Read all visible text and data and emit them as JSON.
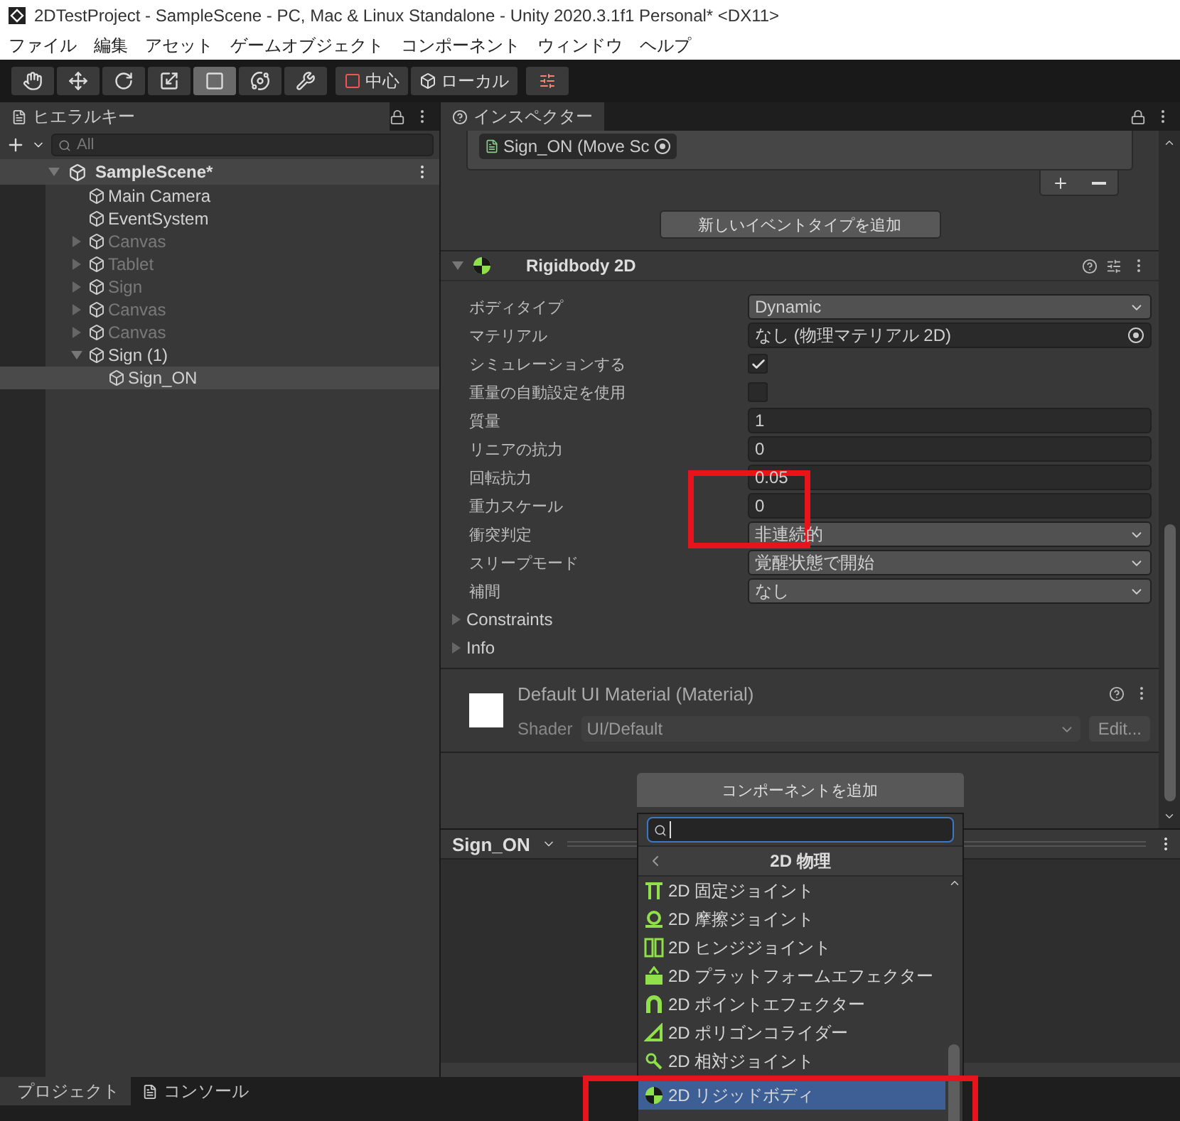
{
  "window": {
    "title": "2DTestProject - SampleScene - PC, Mac & Linux Standalone - Unity 2020.3.1f1 Personal* <DX11>"
  },
  "menu": [
    "ファイル",
    "編集",
    "アセット",
    "ゲームオブジェクト",
    "コンポーネント",
    "ウィンドウ",
    "ヘルプ"
  ],
  "toolbar": {
    "tools": [
      {
        "kind": "hand",
        "selected": false
      },
      {
        "kind": "move",
        "selected": false
      },
      {
        "kind": "rotate",
        "selected": false
      },
      {
        "kind": "scale",
        "selected": false
      },
      {
        "kind": "rect",
        "selected": true
      },
      {
        "kind": "transform",
        "selected": false
      },
      {
        "kind": "custom",
        "selected": false
      }
    ],
    "pivot": "中心",
    "space": "ローカル"
  },
  "hierarchy": {
    "tab": "ヒエラルキー",
    "search_placeholder": "All",
    "scene": "SampleScene*",
    "items": [
      {
        "name": "Main Camera",
        "kind": "leaf",
        "active": true,
        "selected": false
      },
      {
        "name": "EventSystem",
        "kind": "leaf",
        "active": true,
        "selected": false
      },
      {
        "name": "Canvas",
        "kind": "group",
        "expanded": false,
        "active": false,
        "selected": false
      },
      {
        "name": "Tablet",
        "kind": "group",
        "expanded": false,
        "active": false,
        "selected": false
      },
      {
        "name": "Sign",
        "kind": "group",
        "expanded": false,
        "active": false,
        "selected": false
      },
      {
        "name": "Canvas",
        "kind": "group",
        "expanded": false,
        "active": false,
        "selected": false
      },
      {
        "name": "Canvas",
        "kind": "group",
        "expanded": false,
        "active": false,
        "selected": false
      },
      {
        "name": "Sign (1)",
        "kind": "group",
        "expanded": true,
        "active": true,
        "selected": false,
        "children": [
          {
            "name": "Sign_ON",
            "kind": "leaf",
            "active": true,
            "selected": true
          }
        ]
      }
    ]
  },
  "inspector": {
    "tab": "インスペクター",
    "event_object": "Sign_ON (Move Sc",
    "add_event_button": "新しいイベントタイプを追加",
    "component": {
      "title": "Rigidbody 2D",
      "expanded": true,
      "properties": [
        {
          "label": "ボディタイプ",
          "kind": "dropdown",
          "value": "Dynamic"
        },
        {
          "label": "マテリアル",
          "kind": "object",
          "value": "なし (物理マテリアル 2D)"
        },
        {
          "label": "シミュレーションする",
          "kind": "checkbox",
          "checked": true
        },
        {
          "label": "重量の自動設定を使用",
          "kind": "checkbox",
          "checked": false
        },
        {
          "label": "質量",
          "kind": "number",
          "value": "1"
        },
        {
          "label": "リニアの抗力",
          "kind": "number",
          "value": "0"
        },
        {
          "label": "回転抗力",
          "kind": "number",
          "value": "0.05"
        },
        {
          "label": "重力スケール",
          "kind": "number",
          "value": "0"
        },
        {
          "label": "衝突判定",
          "kind": "dropdown",
          "value": "非連続的"
        },
        {
          "label": "スリープモード",
          "kind": "dropdown",
          "value": "覚醒状態で開始"
        },
        {
          "label": "補間",
          "kind": "dropdown",
          "value": "なし"
        }
      ],
      "foldouts": [
        "Constraints",
        "Info"
      ]
    },
    "material": {
      "title": "Default UI Material (Material)",
      "shader_label": "Shader",
      "shader": "UI/Default",
      "edit_button": "Edit..."
    },
    "add_component": "コンポーネントを追加"
  },
  "preview": {
    "title": "Sign_ON"
  },
  "popup": {
    "category": "2D 物理",
    "items": [
      {
        "label": "2D 固定ジョイント",
        "kind": "fixed",
        "selected": false
      },
      {
        "label": "2D 摩擦ジョイント",
        "kind": "friction",
        "selected": false
      },
      {
        "label": "2D ヒンジジョイント",
        "kind": "hinge",
        "selected": false
      },
      {
        "label": "2D プラットフォームエフェクター",
        "kind": "platform",
        "selected": false
      },
      {
        "label": "2D ポイントエフェクター",
        "kind": "point",
        "selected": false
      },
      {
        "label": "2D ポリゴンコライダー",
        "kind": "polygon",
        "selected": false
      },
      {
        "label": "2D 相対ジョイント",
        "kind": "relative",
        "selected": false
      },
      {
        "label": "2D リジッドボディ",
        "kind": "rigidbody",
        "selected": true
      }
    ]
  },
  "bottom_tabs": [
    {
      "label": "プロジェクト",
      "kind": "project",
      "selected": true
    },
    {
      "label": "コンソール",
      "kind": "console",
      "selected": false
    }
  ]
}
